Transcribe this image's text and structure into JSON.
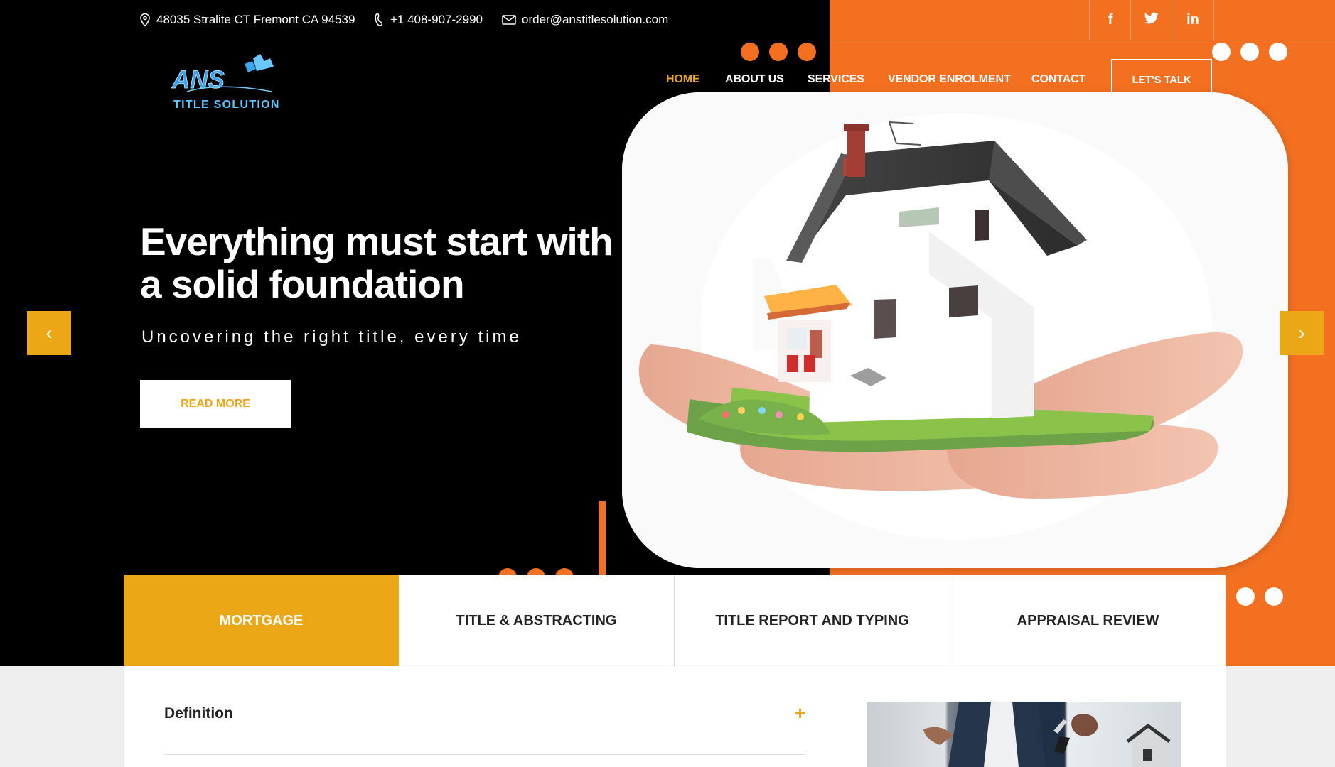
{
  "topbar": {
    "address": "48035 Stralite CT Fremont CA 94539",
    "phone": "+1 408-907-2990",
    "email": "order@anstitlesolution.com",
    "socials": [
      "f",
      "t",
      "in"
    ]
  },
  "brand": {
    "logo_main": "ANS",
    "logo_sub": "TITLE SOLUTION"
  },
  "nav": {
    "items": [
      {
        "label": "HOME"
      },
      {
        "label": "ABOUT US"
      },
      {
        "label": "SERVICES"
      },
      {
        "label": "VENDOR ENROLMENT"
      },
      {
        "label": "CONTACT"
      }
    ],
    "cta": "LET'S TALK"
  },
  "hero": {
    "title": "Everything must start with a solid foundation",
    "subtitle": "Uncovering the right title, every time",
    "button": "READ MORE",
    "prev_icon": "chevron-left-icon",
    "next_icon": "chevron-right-icon"
  },
  "tabs": [
    {
      "label": "MORTGAGE"
    },
    {
      "label": "TITLE & ABSTRACTING"
    },
    {
      "label": "TITLE REPORT AND TYPING"
    },
    {
      "label": "APPRAISAL REVIEW"
    }
  ],
  "content": {
    "accordion_label": "Definition",
    "accordion_icon": "+"
  },
  "colors": {
    "orange": "#f37021",
    "gold": "#eba715",
    "black": "#000000",
    "white": "#ffffff"
  }
}
